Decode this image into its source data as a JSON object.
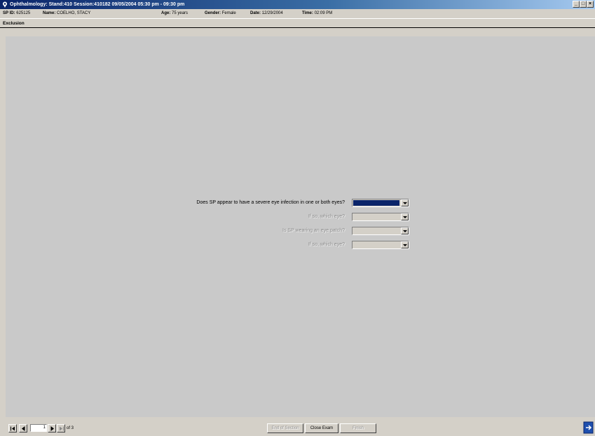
{
  "window": {
    "title": "Ophthalmology: Stand:410 Session:410182 09/05/2004 05:30 pm - 09:30 pm",
    "controls": [
      "_",
      "□",
      "×"
    ]
  },
  "info": {
    "sp_id_label": "SP ID:",
    "sp_id": "625125",
    "name_label": "Name:",
    "name": "COELHO, STACY",
    "age_label": "Age:",
    "age": "75 years",
    "gender_label": "Gender:",
    "gender": "Female",
    "date_label": "Date:",
    "date": "12/29/2004",
    "time_label": "Time:",
    "time": "02:09 PM"
  },
  "section": {
    "title": "Exclusion"
  },
  "questions": [
    {
      "label": "Does SP appear to have a severe eye infection in one or both eyes?",
      "value": "",
      "state": "active"
    },
    {
      "label": "If so, which eye?",
      "value": "",
      "state": "disabled"
    },
    {
      "label": "Is SP wearing an eye patch?",
      "value": "",
      "state": "disabled"
    },
    {
      "label": "If so, which eye?",
      "value": "",
      "state": "disabled"
    }
  ],
  "footer": {
    "page_current": "1",
    "page_total": "of 3",
    "end_section_label": "End of Section",
    "close_exam_label": "Close Exam",
    "finish_label": "Finish"
  },
  "colors": {
    "title_bar": "#0a246a",
    "selection": "#0a246a",
    "panel": "#c9c9c9",
    "chrome": "#d4d0c8"
  }
}
